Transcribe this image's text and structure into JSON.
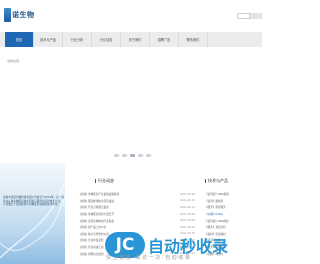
{
  "header": {
    "brand": "诺生物"
  },
  "nav": {
    "items": [
      {
        "label": "首页",
        "active": true
      },
      {
        "label": "技术与产品",
        "active": false
      },
      {
        "label": "行业分析",
        "active": false
      },
      {
        "label": "行业动态",
        "active": false
      },
      {
        "label": "关于我们",
        "active": false
      },
      {
        "label": "招聘广告",
        "active": false
      },
      {
        "label": "联系我们",
        "active": false
      }
    ]
  },
  "breadcrumb": "当前位置：",
  "hero": {
    "text": "深圳市诺瑞生物科技有限公司成立于2013年，是一家专业从事生物医药技术研发与服务的高新技术企业。公司致力于基因检测与生物医药领域的技术转化。"
  },
  "news": {
    "title": "行业动态",
    "items": [
      {
        "title": "[新闻] 生物医药产业最新政策解读",
        "date": "2021-06-18"
      },
      {
        "title": "[新闻] 基因检测技术研究进展",
        "date": "2021-06-15"
      },
      {
        "title": "[新闻] 行业分析报告发布",
        "date": "2021-06-12"
      },
      {
        "title": "[新闻] 生物医药创新大会召开",
        "date": "2021-06-09"
      },
      {
        "title": "[新闻] 诺瑞生物参加行业展会",
        "date": "2021-06-06"
      },
      {
        "title": "[新闻] 新产品上市公告",
        "date": "2021-06-03"
      },
      {
        "title": "[新闻] 技术合作签约仪式",
        "date": "2021-05-30"
      },
      {
        "title": "[新闻] 企业年度总结",
        "date": "2021-05-27"
      },
      {
        "title": "[新闻] 行业动态汇总",
        "date": "2021-05-24"
      },
      {
        "title": "[新闻] 招聘信息更新",
        "date": "2021-05-21"
      }
    ]
  },
  "products": {
    "title": "技术与产品",
    "items": [
      {
        "label": "【试剂盒】DNA提取",
        "highlight": false
      },
      {
        "label": "【试剂】酶制剂",
        "highlight": false
      },
      {
        "label": "【服务】测序服务",
        "highlight": false
      },
      {
        "label": "【仪器】PCR仪",
        "highlight": true
      },
      {
        "label": "【试剂盒】RNA纯化",
        "highlight": false
      },
      {
        "label": "【服务】基因分析",
        "highlight": false
      },
      {
        "label": "【耗材】实验耗材",
        "highlight": false
      },
      {
        "label": "【试剂】抗体",
        "highlight": false
      },
      {
        "label": "【服务】技术咨询",
        "highlight": false
      },
      {
        "label": "【仪器】电泳仪",
        "highlight": false
      }
    ]
  },
  "watermark": {
    "badge": "JC",
    "text": "自动秒收录",
    "sub": "快 上 链 接 · 来 访 一 次 · 自 动 收 录"
  },
  "colors": {
    "accent": "#1d67b5",
    "nav_bg": "#ececec"
  }
}
